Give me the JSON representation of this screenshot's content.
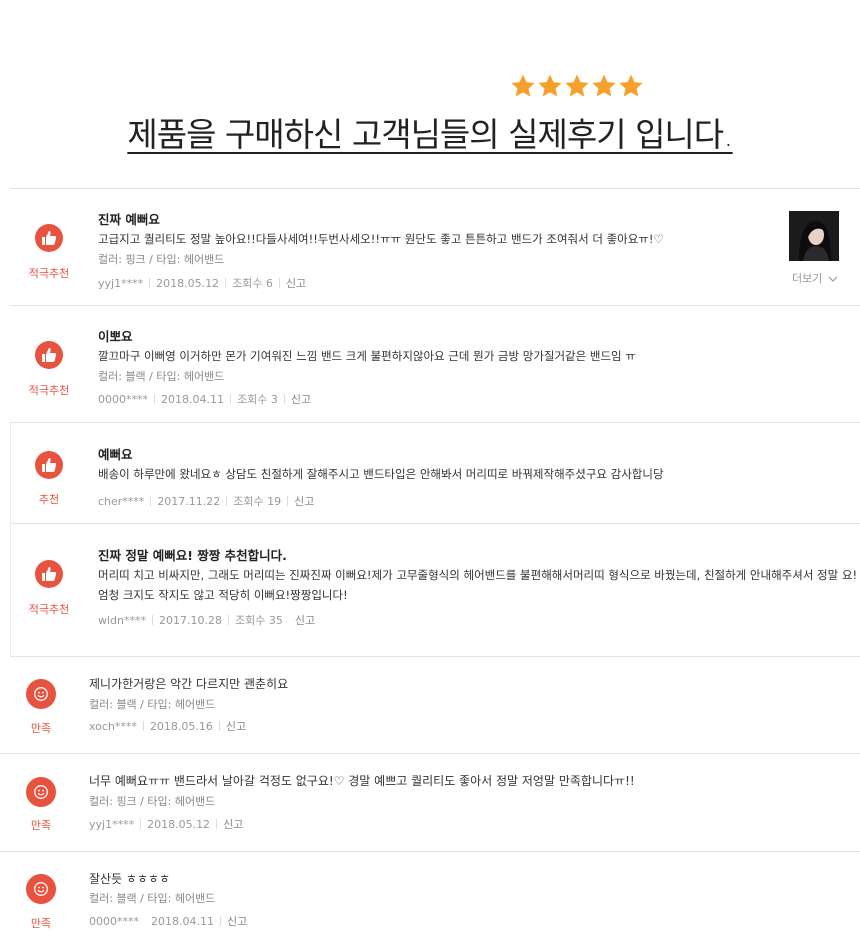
{
  "header": {
    "stars": 5,
    "star_color": "#F5A02A",
    "title": "제품을 구매하신 고객님들의 실제후기 입니다."
  },
  "colors": {
    "accent": "#E8533F"
  },
  "reviews": [
    {
      "badge": "적극추천",
      "icon": "thumbs-up-icon",
      "title": "진짜 예뻐요",
      "body": "고급지고 퀄리티도 정말 높아요!!다들사세여!!두번사세오!!ㅠㅠ 원단도 좋고 튼튼하고 밴드가 조여줘서 더 좋아요ㅠ!♡",
      "option": "컬러: 핑크 / 타입: 헤어밴드",
      "user": "yyj1****",
      "date": "2018.05.12",
      "views": "조회수 6",
      "report": "신고",
      "more": "더보기"
    },
    {
      "badge": "적극추천",
      "icon": "thumbs-up-icon",
      "title": "이뽀요",
      "body": "깔끄마구 이뻐영 이거하만 몬가 기여워진 느낌 밴드 크게 불편하지않아요 근데 뭔가 금방 망가질거같은 밴드임 ㅠ",
      "option": "컬러: 블랙 / 타입: 헤어밴드",
      "user": "0000****",
      "date": "2018.04.11",
      "views": "조회수 3",
      "report": "신고"
    },
    {
      "badge": "추천",
      "icon": "thumbs-up-icon",
      "title": "예뻐요",
      "body": "배송이 하루만에 왔네요ㅎ 상담도 친절하게 잘해주시고 밴드타입은 안해봐서 머리띠로 바꿔제작해주셨구요 감사합니당",
      "user": "cher****",
      "date": "2017.11.22",
      "views": "조회수 19",
      "report": "신고"
    },
    {
      "badge": "적극추천",
      "icon": "thumbs-up-icon",
      "title": "진짜 정말 예뻐요! 짱짱 추천합니다.",
      "body": "머리띠 치고 비싸지만, 그래도 머리띠는 진짜진짜 이뻐요!제가 고무줄형식의 헤어밴드를 불편해해서머리띠 형식으로 바꿨는데, 친절하게 안내해주셔서 정말 요!엄청 크지도 작지도 않고 적당히 이뻐요!짱짱입니다!",
      "user": "wldn****",
      "date": "2017.10.28",
      "views": "조회수 35",
      "report": "신고"
    },
    {
      "badge": "만족",
      "icon": "smile-icon",
      "body": "제니가한거랑은 악간 다르지만 괜춘히요",
      "option": "컬러: 블랙 / 타입: 헤어밴드",
      "user": "xoch****",
      "date": "2018.05.16",
      "report": "신고"
    },
    {
      "badge": "만족",
      "icon": "smile-icon",
      "body": "너무 예뻐요ㅠㅠ 밴드라서 날아갈 걱정도 없구요!♡ 경말 예쁘고 퀄리티도 좋아서 정말 저엉말 만족합니다ㅠ!!",
      "option": "컬러: 핑크 / 타입: 헤어밴드",
      "user": "yyj1****",
      "date": "2018.05.12",
      "report": "신고"
    },
    {
      "badge": "만족",
      "icon": "smile-icon",
      "body": "잘산듯 ㅎㅎㅎㅎ",
      "option": "컬러: 블랙 / 타입: 헤어밴드",
      "user": "0000****",
      "date": "2018.04.11",
      "report": "신고"
    }
  ]
}
